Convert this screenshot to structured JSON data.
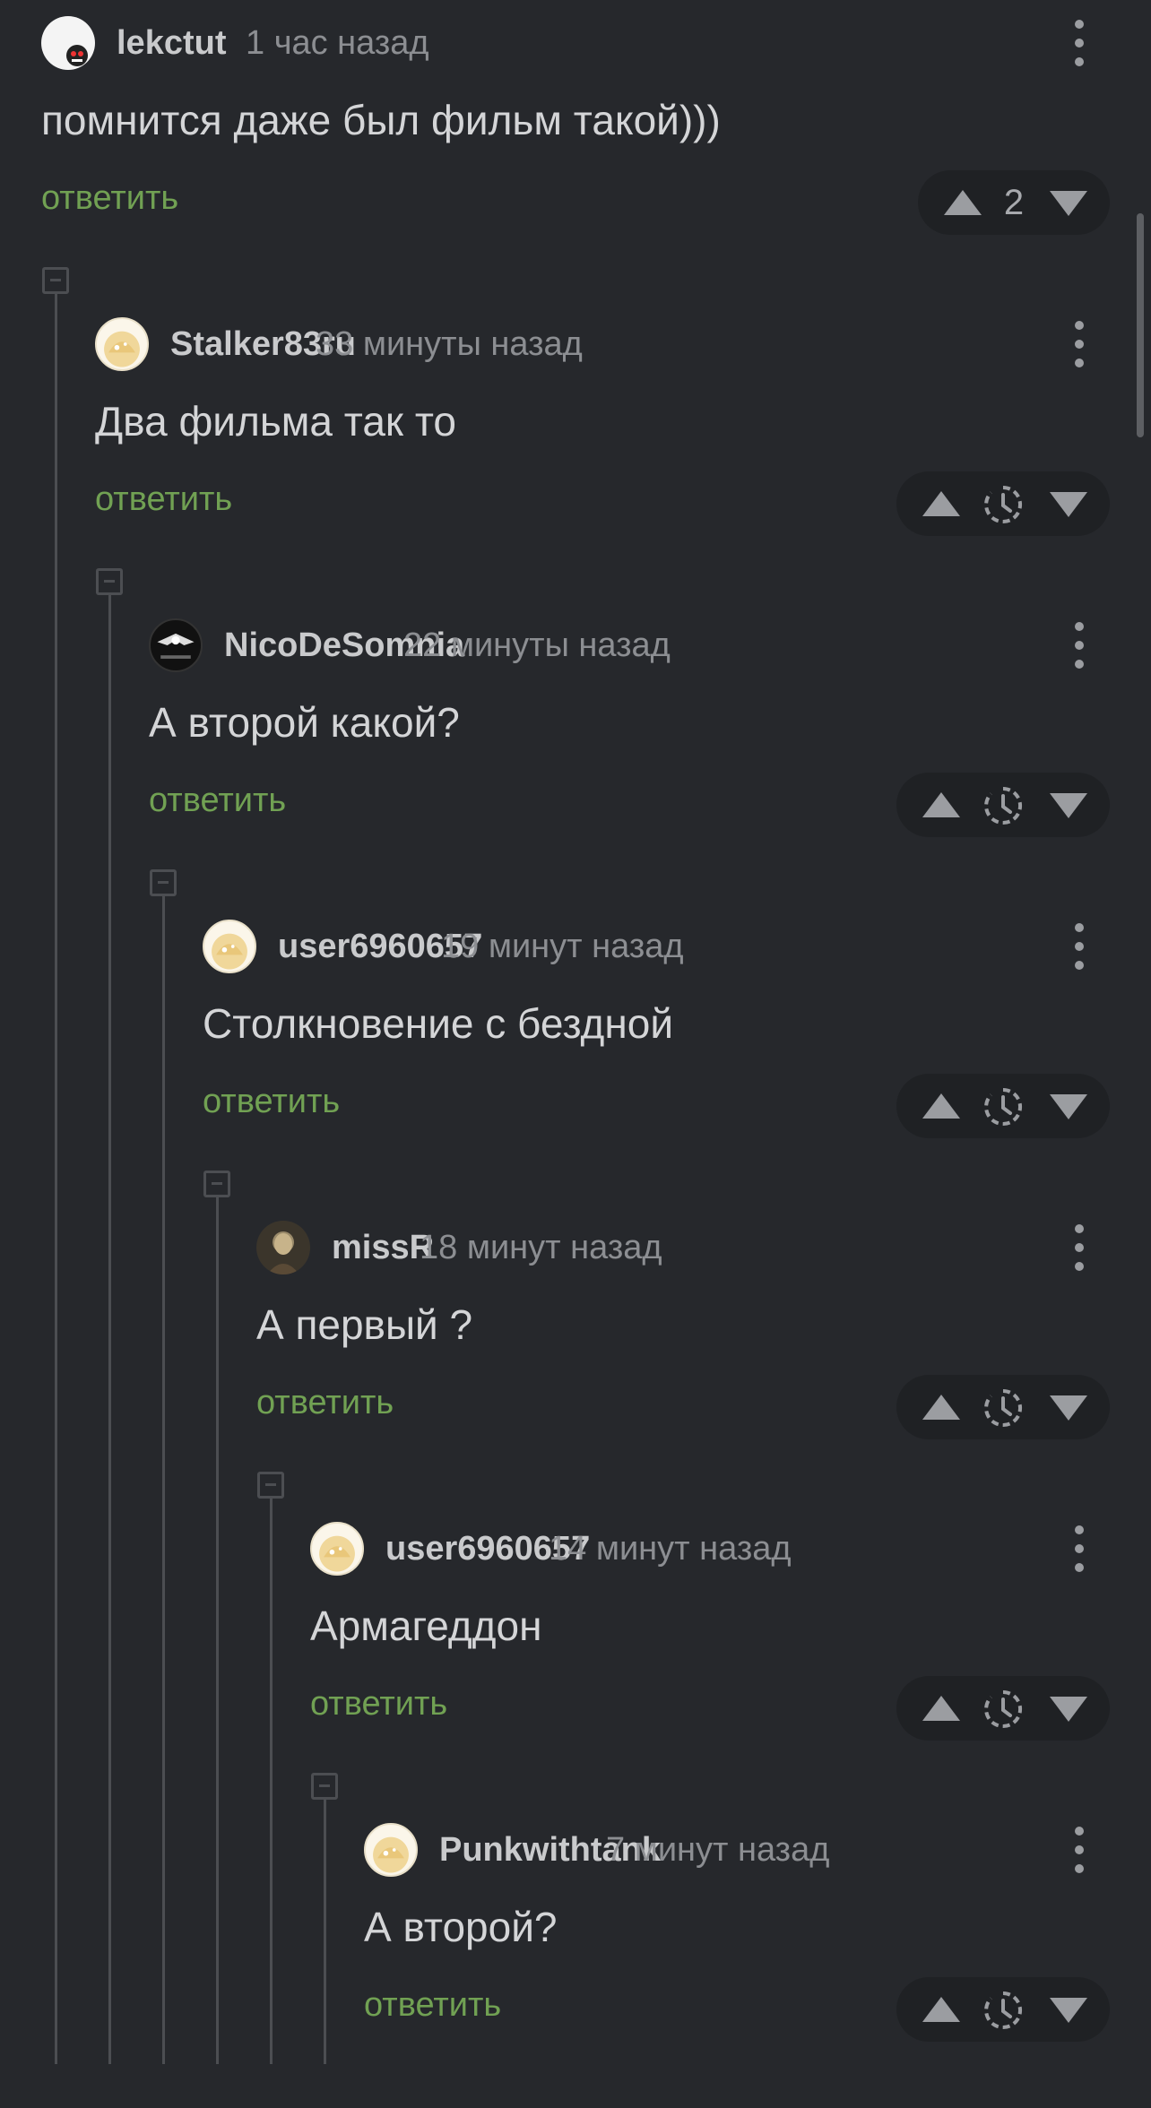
{
  "thread": {
    "reply_label": "ответить",
    "comments": [
      {
        "username": "lekctut",
        "time": "1 час назад",
        "text": "помнится даже был фильм такой)))",
        "rating": "2",
        "avatar": "plain"
      },
      {
        "username": "Stalker83ru",
        "time": "33 минуты назад",
        "text": "Два фильма так то",
        "rating": "",
        "avatar": "pikabu"
      },
      {
        "username": "NicoDeSomnia",
        "time": "22 минуты назад",
        "text": "А второй какой?",
        "rating": "",
        "avatar": "dark"
      },
      {
        "username": "user6960657",
        "time": "19 минут назад",
        "text": "Столкновение с бездной",
        "rating": "",
        "avatar": "pikabu"
      },
      {
        "username": "missR",
        "time": "18 минут назад",
        "text": "А первый ?",
        "rating": "",
        "avatar": "photo"
      },
      {
        "username": "user6960657",
        "time": "14 минут назад",
        "text": "Армагеддон",
        "rating": "",
        "avatar": "pikabu"
      },
      {
        "username": "Punkwithtank",
        "time": "7 минут назад",
        "text": "А второй?",
        "rating": "",
        "avatar": "pikabu"
      }
    ]
  },
  "colors": {
    "background": "#26282c",
    "reply_link": "#71a153",
    "vote_box": "#1f2124",
    "thread_line": "#4c4e52"
  },
  "icons": {
    "vote_up": "triangle-up-icon",
    "vote_down": "triangle-down-icon",
    "rating_hidden": "clock-icon",
    "more": "more-vertical-icon",
    "collapse": "collapse-minus-icon"
  }
}
